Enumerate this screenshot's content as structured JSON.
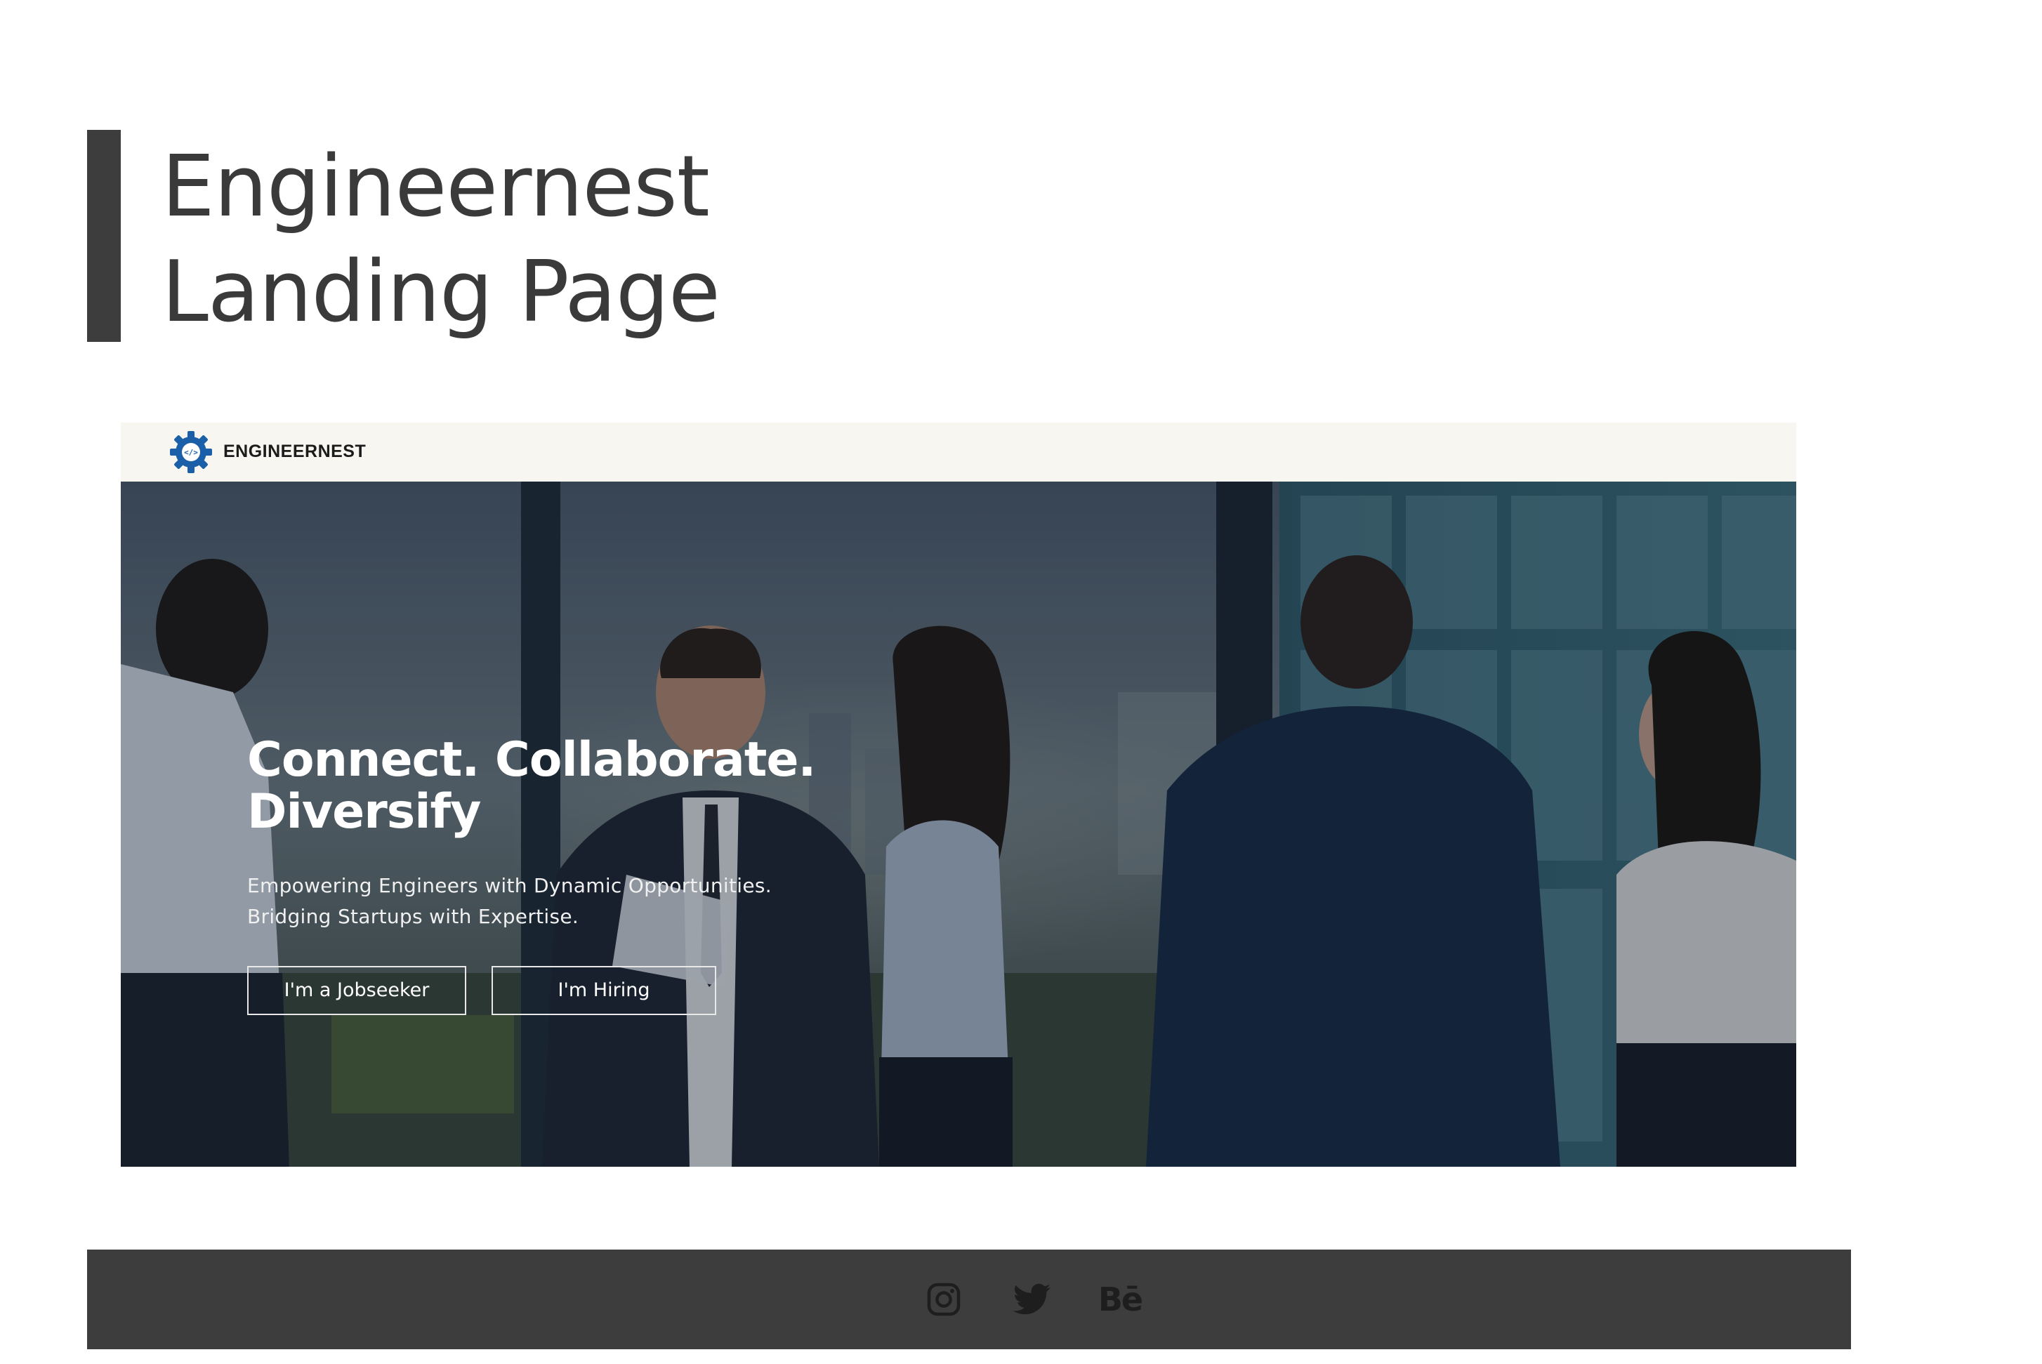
{
  "page": {
    "title_line1": "Engineernest",
    "title_line2": "Landing Page"
  },
  "site": {
    "brand_name": "ENGINEERNEST",
    "brand_logo_glyph": "</>",
    "hero": {
      "headline_line1": "Connect. Collaborate.",
      "headline_line2": "Diversify",
      "subtitle_line1": "Empowering Engineers with Dynamic Opportunities.",
      "subtitle_line2": "Bridging Startups with Expertise.",
      "cta_jobseeker": "I'm a Jobseeker",
      "cta_hiring": "I'm Hiring"
    }
  },
  "footer": {
    "social": [
      {
        "icon": "instagram-icon"
      },
      {
        "icon": "twitter-icon"
      },
      {
        "icon": "behance-icon",
        "label": "Bē"
      }
    ]
  },
  "colors": {
    "accent_dark": "#3d3d3d",
    "title_text": "#3a3a3a",
    "nav_background": "#f8f6f0",
    "logo_blue": "#1a5fa8",
    "hero_text": "#ffffff"
  }
}
